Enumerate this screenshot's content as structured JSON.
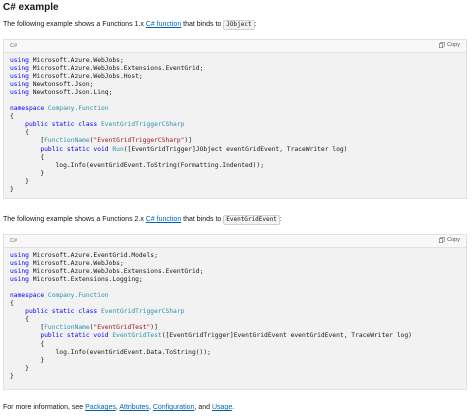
{
  "heading": "C# example",
  "para1": {
    "prefix": "The following example shows a Functions 1.x ",
    "link": "C# function",
    "mid": " that binds to ",
    "code": "JObject",
    "suffix": ":"
  },
  "block1": {
    "lang": "C#",
    "copy_label": "Copy",
    "lines": [
      [
        [
          "kw",
          "using"
        ],
        [
          "",
          "Microsoft.Azure.WebJobs;"
        ]
      ],
      [
        [
          "kw",
          "using"
        ],
        [
          "",
          "Microsoft.Azure.WebJobs.Extensions.EventGrid;"
        ]
      ],
      [
        [
          "kw",
          "using"
        ],
        [
          "",
          "Microsoft.Azure.WebJobs.Host;"
        ]
      ],
      [
        [
          "kw",
          "using"
        ],
        [
          "",
          "Newtonsoft.Json;"
        ]
      ],
      [
        [
          "kw",
          "using"
        ],
        [
          "",
          "Newtonsoft.Json.Linq;"
        ]
      ],
      [],
      [
        [
          "kw",
          "namespace"
        ],
        [
          "ty",
          "Company.Function"
        ]
      ],
      [
        [
          "",
          "{"
        ]
      ],
      [
        [
          "",
          "    "
        ],
        [
          "kw",
          "public static class"
        ],
        [
          "ty",
          "EventGridTriggerCSharp"
        ]
      ],
      [
        [
          "",
          "    {"
        ]
      ],
      [
        [
          "",
          "        ["
        ],
        [
          "ty",
          "FunctionName"
        ],
        [
          "",
          "("
        ],
        [
          "st",
          "\"EventGridTriggerCSharp\""
        ],
        [
          "",
          ")]"
        ]
      ],
      [
        [
          "",
          "        "
        ],
        [
          "kw",
          "public static void"
        ],
        [
          "ty",
          "Run"
        ],
        [
          "",
          "([EventGridTrigger]JObject eventGridEvent, TraceWriter log)"
        ]
      ],
      [
        [
          "",
          "        {"
        ]
      ],
      [
        [
          "",
          "            log.Info(eventGridEvent.ToString(Formatting.Indented));"
        ]
      ],
      [
        [
          "",
          "        }"
        ]
      ],
      [
        [
          "",
          "    }"
        ]
      ],
      [
        [
          "",
          "}"
        ]
      ]
    ]
  },
  "para2": {
    "prefix": "The following example shows a Functions 2.x ",
    "link": "C# function",
    "mid": " that binds to ",
    "code": "EventGridEvent",
    "suffix": ":"
  },
  "block2": {
    "lang": "C#",
    "copy_label": "Copy",
    "lines": [
      [
        [
          "kw",
          "using"
        ],
        [
          "",
          "Microsoft.Azure.EventGrid.Models;"
        ]
      ],
      [
        [
          "kw",
          "using"
        ],
        [
          "",
          "Microsoft.Azure.WebJobs;"
        ]
      ],
      [
        [
          "kw",
          "using"
        ],
        [
          "",
          "Microsoft.Azure.WebJobs.Extensions.EventGrid;"
        ]
      ],
      [
        [
          "kw",
          "using"
        ],
        [
          "",
          "Microsoft.Extensions.Logging;"
        ]
      ],
      [],
      [
        [
          "kw",
          "namespace"
        ],
        [
          "ty",
          "Company.Function"
        ]
      ],
      [
        [
          "",
          "{"
        ]
      ],
      [
        [
          "",
          "    "
        ],
        [
          "kw",
          "public static class"
        ],
        [
          "ty",
          "EventGridTriggerCSharp"
        ]
      ],
      [
        [
          "",
          "    {"
        ]
      ],
      [
        [
          "",
          "        ["
        ],
        [
          "ty",
          "FunctionName"
        ],
        [
          "",
          "("
        ],
        [
          "st",
          "\"EventGridTest\""
        ],
        [
          "",
          ")]"
        ]
      ],
      [
        [
          "",
          "        "
        ],
        [
          "kw",
          "public static void"
        ],
        [
          "ty",
          "EventGridTest"
        ],
        [
          "",
          "([EventGridTrigger]EventGridEvent eventGridEvent, TraceWriter log)"
        ]
      ],
      [
        [
          "",
          "        {"
        ]
      ],
      [
        [
          "",
          "            log.Info(eventGridEvent.Data.ToString());"
        ]
      ],
      [
        [
          "",
          "        }"
        ]
      ],
      [
        [
          "",
          "    }"
        ]
      ],
      [
        [
          "",
          "}"
        ]
      ]
    ]
  },
  "footer": {
    "prefix": "For more information, see ",
    "links": [
      "Packages",
      "Attributes",
      "Configuration",
      "Usage"
    ],
    "sep1": ", ",
    "sep2": ", ",
    "sep3": ", and ",
    "suffix": "."
  },
  "colors": {
    "keyword": "#0101fd",
    "type": "#2b91af",
    "string": "#a31515",
    "link": "#0065b3",
    "code_bg": "#f2f2f2"
  }
}
